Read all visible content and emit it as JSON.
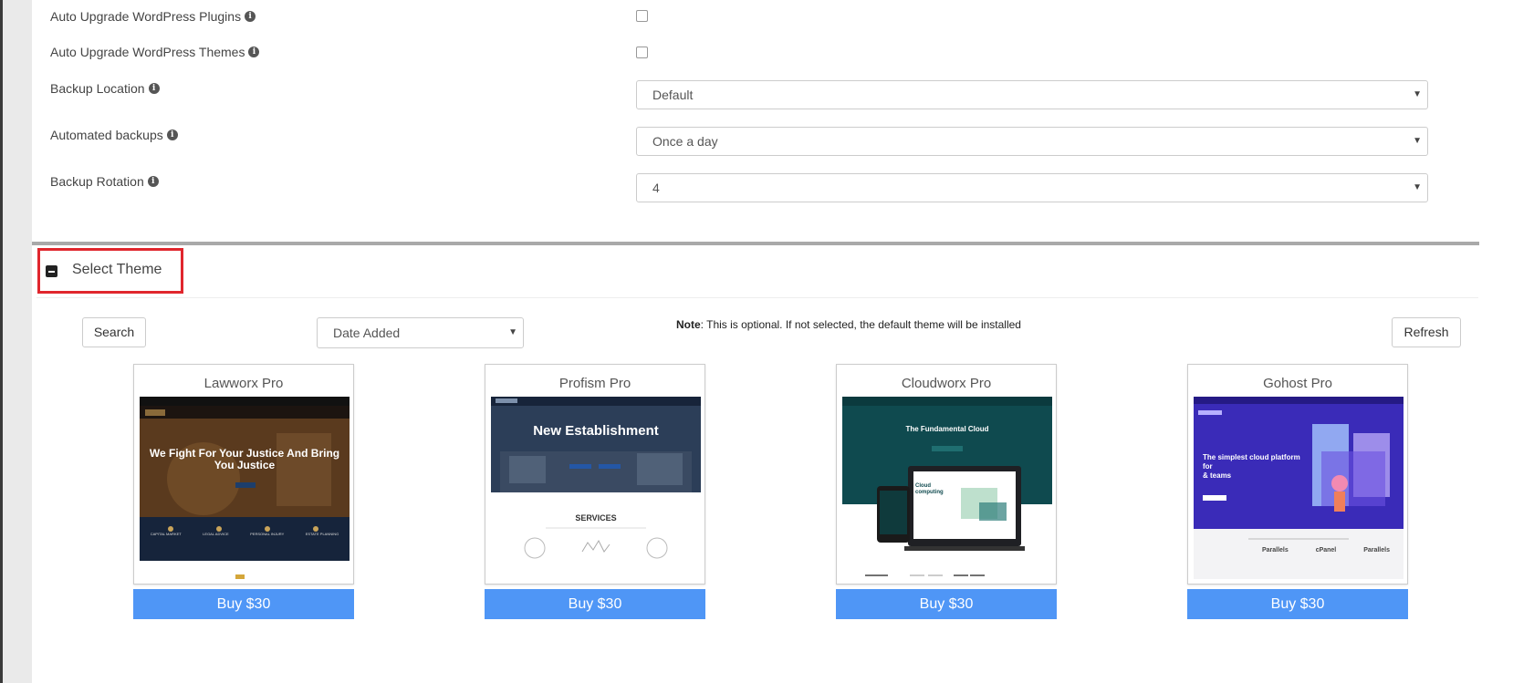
{
  "settings": {
    "auto_plugins_label": "Auto Upgrade WordPress Plugins",
    "auto_themes_label": "Auto Upgrade WordPress Themes",
    "backup_location_label": "Backup Location",
    "backup_location_value": "Default",
    "automated_backups_label": "Automated backups",
    "automated_backups_value": "Once a day",
    "backup_rotation_label": "Backup Rotation",
    "backup_rotation_value": "4",
    "info_icon": "i"
  },
  "theme_section": {
    "title": "Select Theme",
    "search_label": "Search",
    "sort_value": "Date Added",
    "note_bold": "Note",
    "note_text": ": This is optional. If not selected, the default theme will be installed",
    "refresh_label": "Refresh",
    "cards": [
      {
        "name": "Lawworx Pro",
        "buy": "Buy  $30",
        "hero": "We Fight For Your Justice And Bring You Justice",
        "features": [
          "CAPITAL MARKET",
          "LEGAL ADVICE",
          "PERSONAL INJURY",
          "ESTATE PLANNING"
        ]
      },
      {
        "name": "Profism Pro",
        "buy": "Buy  $30",
        "hero": "New Establishment",
        "sub": "SERVICES"
      },
      {
        "name": "Cloudworx Pro",
        "buy": "Buy  $30",
        "hero": "The Fundamental Cloud",
        "sub": "Cloud computing"
      },
      {
        "name": "Gohost Pro",
        "buy": "Buy  $30",
        "hero": "The simplest cloud platform for",
        "sub": "& teams",
        "partners": [
          "Parallels",
          "cPanel",
          "Parallels"
        ]
      }
    ]
  },
  "colors": {
    "buy_button": "#4f96f6",
    "highlight_border": "#e0262d"
  }
}
